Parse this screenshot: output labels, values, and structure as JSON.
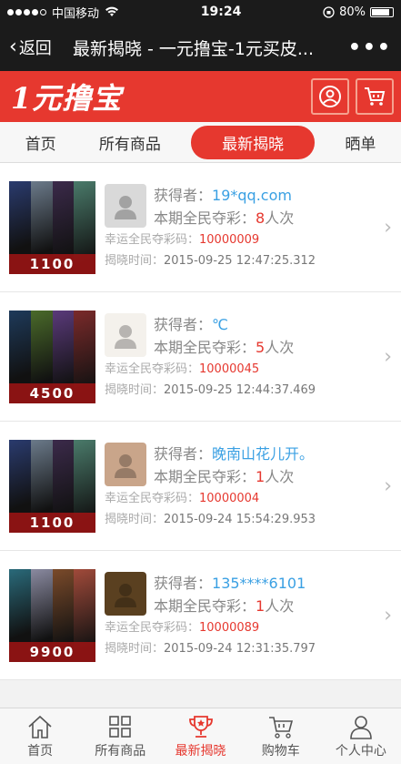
{
  "status": {
    "carrier": "中国移动",
    "time": "19:24",
    "battery": "80%"
  },
  "nav": {
    "back_label": "返回",
    "title": "最新揭晓 - 一元撸宝-1元买皮...",
    "more_label": "•••"
  },
  "brand": {
    "logo_text": "1元撸宝"
  },
  "tabs": [
    {
      "label": "首页"
    },
    {
      "label": "所有商品"
    },
    {
      "label": "最新揭晓"
    },
    {
      "label": "晒单"
    }
  ],
  "labels": {
    "winner": "获得者：",
    "times": "本期全民夺彩：",
    "times_unit": "人次",
    "lucky_code": "幸运全民夺彩码：",
    "reveal_time": "揭晓时间："
  },
  "items": [
    {
      "price": "1100",
      "winner": "19*qq.com",
      "count": "8",
      "code": "10000009",
      "time": "2015-09-25 12:47:25.312",
      "colors": [
        "#2a3b6e",
        "#6b7a8a",
        "#3b2a4a",
        "#4a7a6a"
      ],
      "avatar_color": "#d9d9d9"
    },
    {
      "price": "4500",
      "winner": "℃",
      "count": "5",
      "code": "10000045",
      "time": "2015-09-25 12:44:37.469",
      "colors": [
        "#1e3a5a",
        "#4a6a2a",
        "#5a3a7a",
        "#7a2a2a"
      ],
      "avatar_color": "#f4f1ec"
    },
    {
      "price": "1100",
      "winner": "晚南山花儿开。",
      "count": "1",
      "code": "10000004",
      "time": "2015-09-24 15:54:29.953",
      "colors": [
        "#2a3b6e",
        "#6b7a8a",
        "#3b2a4a",
        "#4a7a6a"
      ],
      "avatar_color": "#c9a58a"
    },
    {
      "price": "9900",
      "winner": "135****6101",
      "count": "1",
      "code": "10000089",
      "time": "2015-09-24 12:31:35.797",
      "colors": [
        "#2a6a7a",
        "#8a8aa0",
        "#7a4a2a",
        "#a04a3a"
      ],
      "avatar_color": "#5a4020"
    }
  ],
  "tabbar": [
    {
      "label": "首页",
      "icon": "home-icon"
    },
    {
      "label": "所有商品",
      "icon": "grid-icon"
    },
    {
      "label": "最新揭晓",
      "icon": "trophy-icon"
    },
    {
      "label": "购物车",
      "icon": "cart-icon"
    },
    {
      "label": "个人中心",
      "icon": "user-icon"
    }
  ],
  "colors": {
    "brand": "#e6382f",
    "link": "#3aa0e3"
  }
}
